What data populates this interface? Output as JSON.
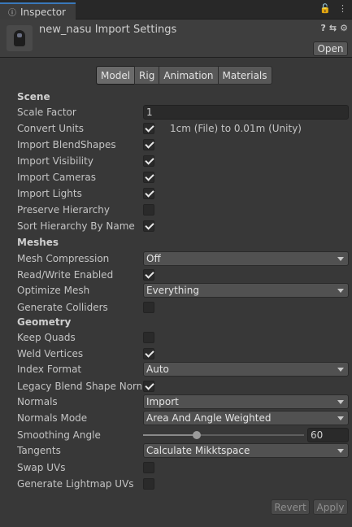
{
  "window": {
    "tab_label": "Inspector",
    "tab_icon": "info-icon"
  },
  "header": {
    "title": "new_nasu Import Settings",
    "open_label": "Open"
  },
  "tabs": [
    {
      "label": "Model",
      "active": true
    },
    {
      "label": "Rig",
      "active": false
    },
    {
      "label": "Animation",
      "active": false
    },
    {
      "label": "Materials",
      "active": false
    }
  ],
  "scene": {
    "heading": "Scene",
    "scale_factor": {
      "label": "Scale Factor",
      "value": "1"
    },
    "convert_units": {
      "label": "Convert Units",
      "checked": true,
      "note": "1cm (File) to 0.01m (Unity)"
    },
    "import_blendshapes": {
      "label": "Import BlendShapes",
      "checked": true
    },
    "import_visibility": {
      "label": "Import Visibility",
      "checked": true
    },
    "import_cameras": {
      "label": "Import Cameras",
      "checked": true
    },
    "import_lights": {
      "label": "Import Lights",
      "checked": true
    },
    "preserve_hierarchy": {
      "label": "Preserve Hierarchy",
      "checked": false
    },
    "sort_hierarchy": {
      "label": "Sort Hierarchy By Name",
      "checked": true
    }
  },
  "meshes": {
    "heading": "Meshes",
    "mesh_compression": {
      "label": "Mesh Compression",
      "value": "Off"
    },
    "read_write": {
      "label": "Read/Write Enabled",
      "checked": true
    },
    "optimize_mesh": {
      "label": "Optimize Mesh",
      "value": "Everything"
    },
    "generate_colliders": {
      "label": "Generate Colliders",
      "checked": false
    }
  },
  "geometry": {
    "heading": "Geometry",
    "keep_quads": {
      "label": "Keep Quads",
      "checked": false
    },
    "weld_vertices": {
      "label": "Weld Vertices",
      "checked": true
    },
    "index_format": {
      "label": "Index Format",
      "value": "Auto"
    },
    "legacy_blend": {
      "label": "Legacy Blend Shape Norma",
      "checked": true
    },
    "normals": {
      "label": "Normals",
      "value": "Import"
    },
    "normals_mode": {
      "label": "Normals Mode",
      "value": "Area And Angle Weighted"
    },
    "smoothing_angle": {
      "label": "Smoothing Angle",
      "value": "60",
      "fraction": 0.333
    },
    "tangents": {
      "label": "Tangents",
      "value": "Calculate Mikktspace"
    },
    "swap_uvs": {
      "label": "Swap UVs",
      "checked": false
    },
    "generate_lightmap": {
      "label": "Generate Lightmap UVs",
      "checked": false
    }
  },
  "footer": {
    "revert_label": "Revert",
    "apply_label": "Apply"
  }
}
